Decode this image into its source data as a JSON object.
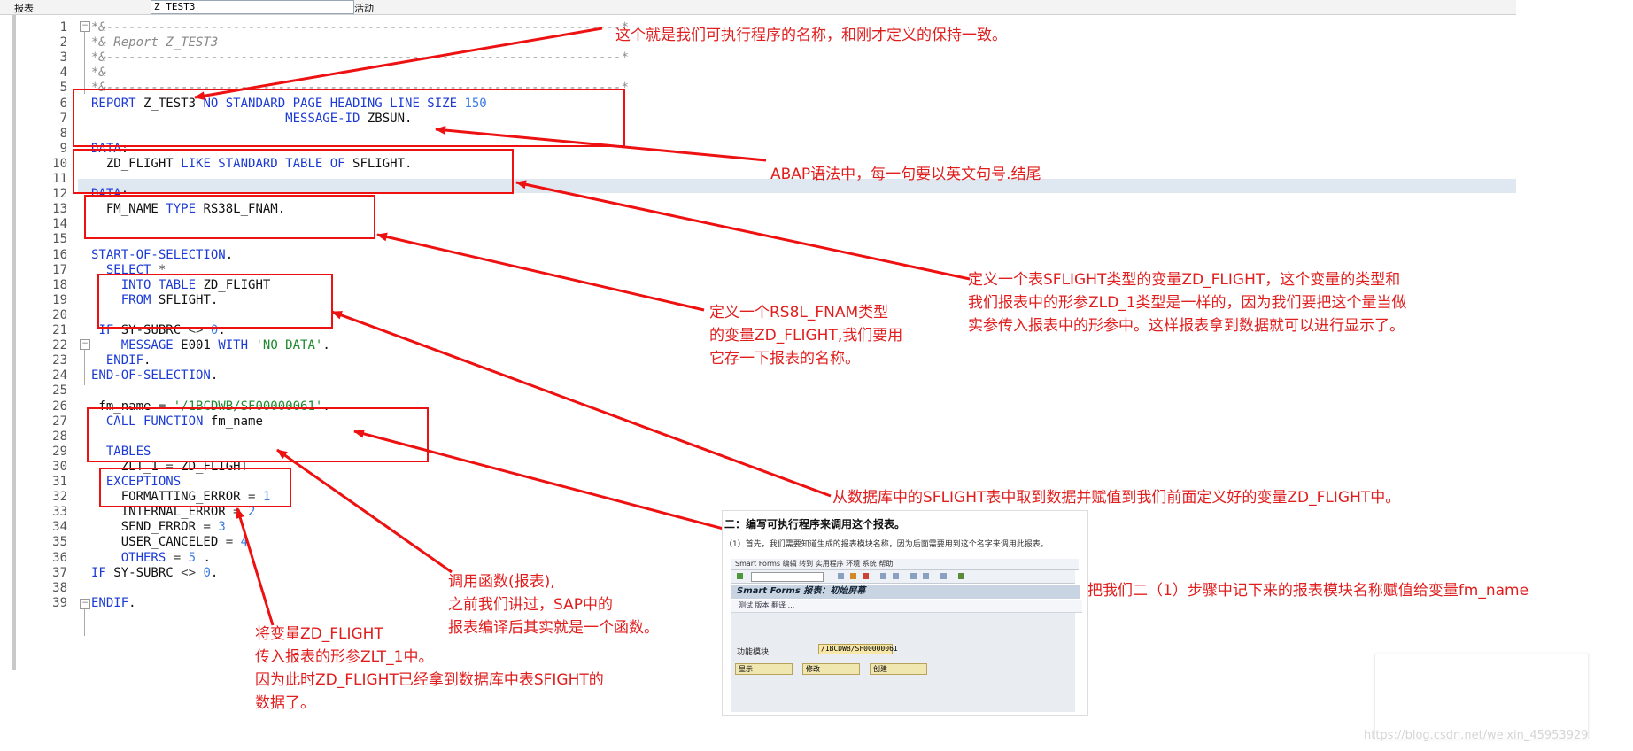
{
  "topbar": {
    "label": "报表",
    "field": "Z_TEST3",
    "status": "活动"
  },
  "lines": [
    {
      "n": "1",
      "html": "<span class='cm'>*&amp;---------------------------------------------------------------------*</span>"
    },
    {
      "n": "2",
      "html": "<span class='cm'>*&amp; Report Z_TEST3</span>"
    },
    {
      "n": "3",
      "html": "<span class='cm'>*&amp;---------------------------------------------------------------------*</span>"
    },
    {
      "n": "4",
      "html": "<span class='cm'>*&amp;</span>"
    },
    {
      "n": "5",
      "html": "<span class='cm'>*&amp;---------------------------------------------------------------------*</span>"
    },
    {
      "n": "6",
      "html": "<span class='kw'>REPORT</span> Z_TEST3 <span class='kw'>NO STANDARD PAGE HEADING LINE SIZE</span> <span class='num'>150</span>"
    },
    {
      "n": "7",
      "html": "                          <span class='kw'>MESSAGE-ID</span> ZBSUN."
    },
    {
      "n": "8",
      "html": ""
    },
    {
      "n": "9",
      "html": "<span class='kw'>DATA</span>:"
    },
    {
      "n": "10",
      "html": "  ZD_FLIGHT <span class='kw'>LIKE STANDARD TABLE OF</span> SFLIGHT."
    },
    {
      "n": "11",
      "html": ""
    },
    {
      "n": "12",
      "html": "<span class='kw'>DATA</span>:"
    },
    {
      "n": "13",
      "html": "  FM_NAME <span class='kw'>TYPE</span> RS38L_FNAM."
    },
    {
      "n": "14",
      "html": ""
    },
    {
      "n": "15",
      "html": ""
    },
    {
      "n": "16",
      "html": "<span class='kw'>START-OF-SELECTION</span>."
    },
    {
      "n": "17",
      "html": "  <span class='kw'>SELECT</span> <span class='op'>*</span>"
    },
    {
      "n": "18",
      "html": "    <span class='kw'>INTO TABLE</span> ZD_FLIGHT"
    },
    {
      "n": "19",
      "html": "    <span class='kw'>FROM</span> SFLIGHT."
    },
    {
      "n": "20",
      "html": ""
    },
    {
      "n": "21",
      "html": " <span class='kw'>IF</span> SY-SUBRC <span class='op'>&lt;&gt;</span> <span class='num'>0</span>."
    },
    {
      "n": "22",
      "html": "    <span class='kw'>MESSAGE</span> E001 <span class='kw'>WITH</span> <span class='str'>'NO DATA'</span>."
    },
    {
      "n": "23",
      "html": "  <span class='kw'>ENDIF</span>."
    },
    {
      "n": "24",
      "html": "<span class='kw'>END-OF-SELECTION</span>."
    },
    {
      "n": "25",
      "html": ""
    },
    {
      "n": "26",
      "html": " fm_name <span class='op'>=</span> <span class='str'>'/1BCDWB/SF00000061'</span>."
    },
    {
      "n": "27",
      "html": "  <span class='kw'>CALL FUNCTION</span> fm_name"
    },
    {
      "n": "28",
      "html": ""
    },
    {
      "n": "29",
      "html": "  <span class='kw'>TABLES</span>"
    },
    {
      "n": "30",
      "html": "    ZLT_1 <span class='op'>=</span> ZD_FLIGHT"
    },
    {
      "n": "31",
      "html": "  <span class='kw'>EXCEPTIONS</span>"
    },
    {
      "n": "32",
      "html": "    FORMATTING_ERROR <span class='op'>=</span> <span class='num'>1</span>"
    },
    {
      "n": "33",
      "html": "    INTERNAL_ERROR <span class='op'>=</span> <span class='num'>2</span>"
    },
    {
      "n": "34",
      "html": "    SEND_ERROR <span class='op'>=</span> <span class='num'>3</span>"
    },
    {
      "n": "35",
      "html": "    USER_CANCELED <span class='op'>=</span> <span class='num'>4</span>"
    },
    {
      "n": "36",
      "html": "    <span class='kw'>OTHERS</span> <span class='op'>=</span> <span class='num'>5</span> ."
    },
    {
      "n": "37",
      "html": "<span class='kw'>IF</span> SY-SUBRC <span class='op'>&lt;&gt;</span> <span class='num'>0</span>."
    },
    {
      "n": "38",
      "html": ""
    },
    {
      "n": "39",
      "html": "<span class='kw'>ENDIF</span>."
    }
  ],
  "notes": {
    "n1": "这个就是我们可执行程序的名称，和刚才定义的保持一致。",
    "n2": "ABAP语法中，每一句要以英文句号.结尾",
    "n3": "定义一个表SFLIGHT类型的变量ZD_FLIGHT，这个变量的类型和\n我们报表中的形参ZLD_1类型是一样的，因为我们要把这个量当做\n实参传入报表中的形参中。这样报表拿到数据就可以进行显示了。",
    "n4": "定义一个RS8L_FNAM类型\n的变量ZD_FLIGHT,我们要用\n它存一下报表的名称。",
    "n5": "从数据库中的SFLIGHT表中取到数据并赋值到我们前面定义好的变量ZD_FLIGHT中。",
    "n6": "把我们二（1）步骤中记下来的报表模块名称赋值给变量fm_name",
    "n7": "调用函数(报表),\n之前我们讲过，SAP中的\n报表编译后其实就是一个函数。",
    "n8": "将变量ZD_FLIGHT\n传入报表的形参ZLT_1中。\n因为此时ZD_FLIGHT已经拿到数据库中表SFIGHT的\n数据了。"
  },
  "shot": {
    "heading": "二：编写可执行程序来调用这个报表。",
    "desc": "（1）首先，我们需要知道生成的报表模块名称，因为后面需要用到这个名字来调用此报表。",
    "menu": "Smart Forms   编辑   转到   实用程序   环境   系统   帮助",
    "title": "Smart Forms 报表：初始屏幕",
    "tool2": "测试   版本   翻译   ...",
    "field_label": "功能模块",
    "field_value": "/1BCDWB/SF00000061",
    "btn1": "显示",
    "btn2": "修改",
    "btn3": "创建"
  },
  "watermark": "https://blog.csdn.net/weixin_45953929"
}
